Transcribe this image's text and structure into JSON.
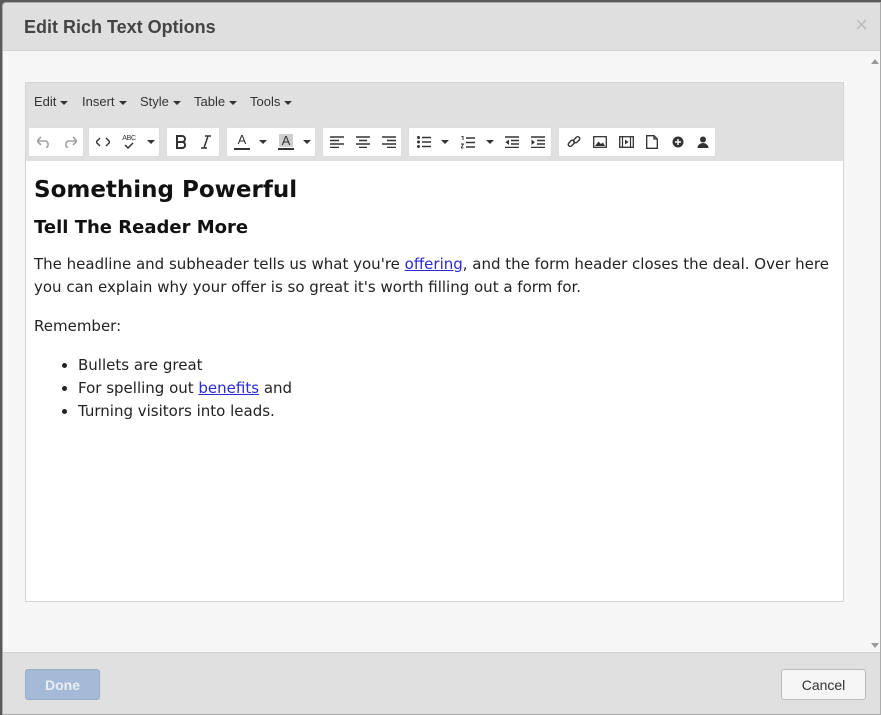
{
  "modal": {
    "title": "Edit Rich Text Options",
    "close_glyph": "×"
  },
  "menubar": {
    "items": [
      "Edit",
      "Insert",
      "Style",
      "Table",
      "Tools"
    ]
  },
  "toolbar": {
    "icons": [
      "undo-icon",
      "redo-icon",
      "source-code-icon",
      "spellcheck-icon",
      "bold-icon",
      "italic-icon",
      "text-color-icon",
      "background-color-icon",
      "align-left-icon",
      "align-center-icon",
      "align-right-icon",
      "bullet-list-icon",
      "numbered-list-icon",
      "outdent-icon",
      "indent-icon",
      "link-icon",
      "image-icon",
      "media-icon",
      "template-icon",
      "special-char-icon",
      "person-icon"
    ],
    "spellcheck_label": "ABC",
    "text_color_letter": "A",
    "bg_color_letter": "A"
  },
  "content": {
    "heading1": "Something Powerful",
    "heading2": "Tell The Reader More",
    "para1_before": "The headline and subheader tells us what you're ",
    "para1_link": "offering",
    "para1_after": ", and the form header closes the deal. Over here you can explain why your offer is so great it's worth filling out a form for.",
    "para2": "Remember:",
    "bullet1": "Bullets are great",
    "bullet2_before": "For spelling out ",
    "bullet2_link": "benefits",
    "bullet2_after": " and",
    "bullet3": "Turning visitors into leads."
  },
  "footer": {
    "done_label": "Done",
    "cancel_label": "Cancel"
  },
  "colors": {
    "header_bg": "#dfdfdf",
    "toolbar_bg": "#e0e0e0",
    "link": "#2a2ad6",
    "done_disabled_bg": "#a4bad6"
  }
}
